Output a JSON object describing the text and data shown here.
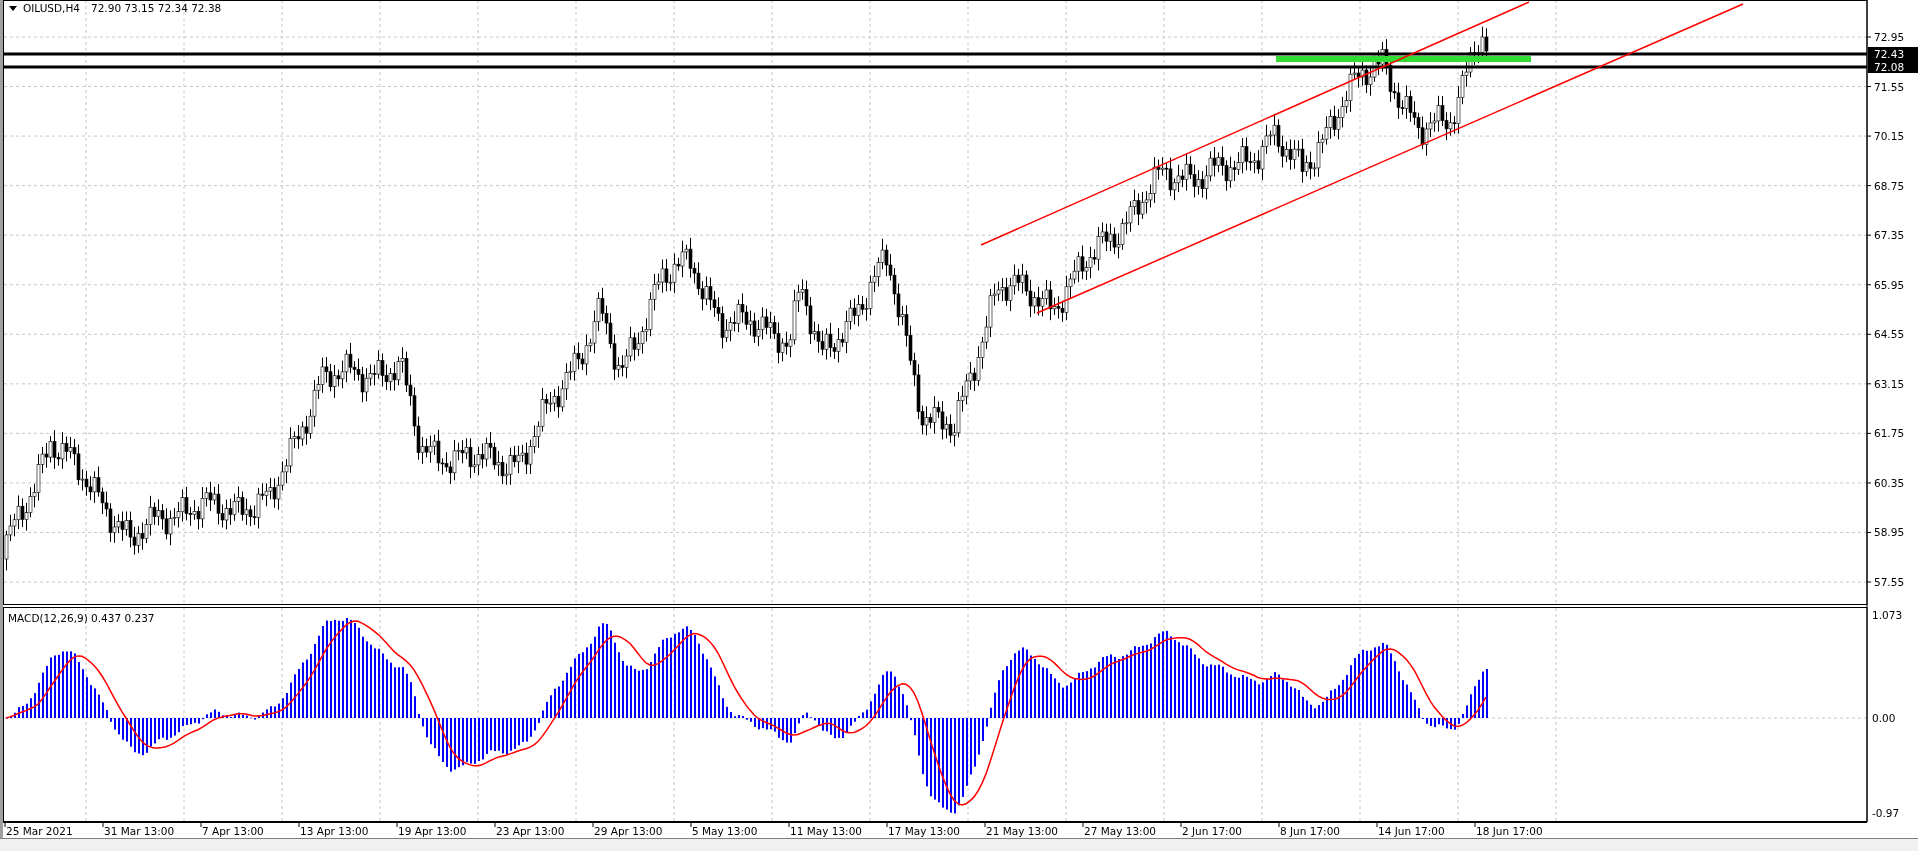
{
  "chart_header": {
    "symbol": "OILUSD,H4",
    "ohlc": [
      "72.90",
      "73.15",
      "72.34",
      "72.38"
    ]
  },
  "price_axis": [
    "72.95",
    "71.55",
    "70.15",
    "68.75",
    "67.35",
    "65.95",
    "64.55",
    "63.15",
    "61.75",
    "60.35",
    "58.95",
    "57.55"
  ],
  "level_markers": [
    "72.43",
    "72.08"
  ],
  "indicator_header": {
    "name": "MACD(12,26,9)",
    "values": [
      "0.437",
      "0.237"
    ]
  },
  "indicator_axis": [
    "1.073",
    "0.00",
    "-0.97"
  ],
  "time_axis": [
    "25 Mar 2021",
    "31 Mar 13:00",
    "7 Apr 13:00",
    "13 Apr 13:00",
    "19 Apr 13:00",
    "23 Apr 13:00",
    "29 Apr 13:00",
    "5 May 13:00",
    "11 May 13:00",
    "17 May 13:00",
    "21 May 13:00",
    "27 May 13:00",
    "2 Jun 17:00",
    "8 Jun 17:00",
    "14 Jun 17:00",
    "18 Jun 17:00"
  ]
}
